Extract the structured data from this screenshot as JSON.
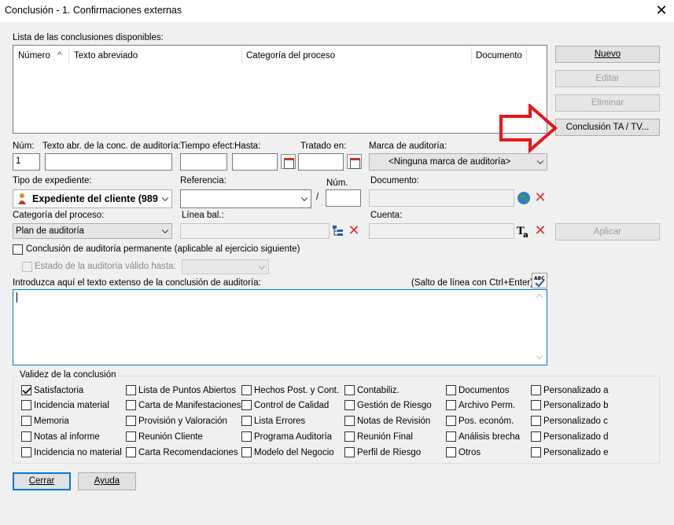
{
  "window": {
    "title": "Conclusión - 1. Confirmaciones externas",
    "close_glyph": "✕"
  },
  "list": {
    "label": "Lista de las conclusiones disponibles:",
    "columns": [
      "Número",
      "Texto abreviado",
      "Categoría del proceso",
      "Documento"
    ],
    "sort_glyph": "^"
  },
  "buttons": {
    "nuevo": "Nuevo",
    "editar": "Editar",
    "eliminar": "Eliminar",
    "conclusion_ta": "Conclusión TA / TV...",
    "aplicar": "Aplicar",
    "cerrar": "Cerrar",
    "ayuda": "Ayuda"
  },
  "fields": {
    "num_label": "Núm:",
    "num_value": "1",
    "texto_label": "Texto abr. de la conc. de auditoría:",
    "tiempo_label": "Tiempo efect:",
    "hasta_label": "Hasta:",
    "tratado_label": "Tratado en:",
    "marca_label": "Marca de auditoría:",
    "marca_value": "<Ninguna marca de auditoría>",
    "tipo_label": "Tipo de expediente:",
    "tipo_value": "Expediente del cliente (989?",
    "referencia_label": "Referencia:",
    "slash": "/",
    "num2_label": "Núm.",
    "documento_label": "Documento:",
    "categoria_label": "Categoría del proceso:",
    "categoria_value": "Plan de auditoría",
    "linea_label": "Línea bal.:",
    "cuenta_label": "Cuenta:",
    "permanente_label": "Conclusión de auditoría permanente (aplicable al ejercicio siguiente)",
    "estado_label": "Estado de la auditoría válido hasta:",
    "texto_extenso_label": "Introduzca aquí el texto extenso de la conclusión de auditoría:",
    "salto_hint": "(Salto de línea con Ctrl+Enter)"
  },
  "validez": {
    "title": "Validez de la conclusión",
    "columns": [
      [
        "Satisfactoria",
        "Incidencia material",
        "Memoria",
        "Notas al informe",
        "Incidencia no material"
      ],
      [
        "Lista de Puntos Abiertos",
        "Carta de Manifestaciones",
        "Provisión y Valoración",
        "Reunión Cliente",
        "Carta Recomendaciones"
      ],
      [
        "Hechos Post. y Cont.",
        "Control de Calidad",
        "Lista Errores",
        "Programa Auditoría",
        "Modelo del Negocio"
      ],
      [
        "Contabiliz.",
        "Gestión de Riesgo",
        "Notas de Revisión",
        "Reunión Final",
        "Perfil de Riesgo"
      ],
      [
        "Documentos",
        "Archivo Perm.",
        "Pos. económ.",
        "Análisis brecha",
        "Otros"
      ],
      [
        "Personalizado a",
        "Personalizado b",
        "Personalizado c",
        "Personalizado d",
        "Personalizado e"
      ]
    ],
    "checked": [
      "Satisfactoria"
    ]
  },
  "colors": {
    "accent": "#0078d7",
    "arrow": "#e8141b"
  },
  "icons": [
    "calendar-icon",
    "globe-icon",
    "delete-icon",
    "tree-icon",
    "text-tag-icon",
    "spellcheck-icon",
    "person-icon"
  ]
}
